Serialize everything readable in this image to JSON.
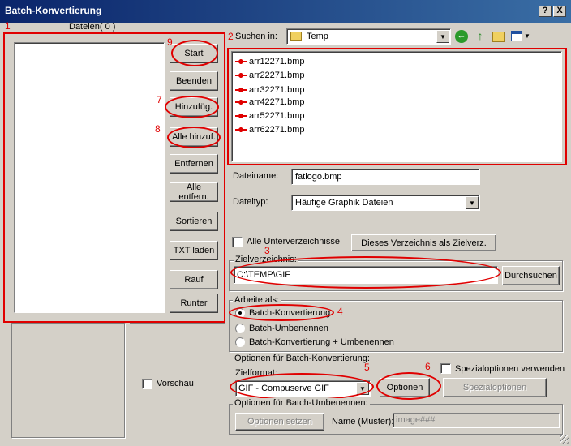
{
  "window": {
    "title": "Batch-Konvertierung",
    "help_label": "?",
    "close_label": "X"
  },
  "markers": [
    "1",
    "2",
    "3",
    "4",
    "5",
    "6",
    "7",
    "8",
    "9"
  ],
  "left": {
    "header": "Dateien( 0 )",
    "buttons": {
      "start": "Start",
      "beenden": "Beenden",
      "hinzufueg": "Hinzufüg.",
      "alle_hinzuf": "Alle hinzuf.",
      "entfernen": "Entfernen",
      "alle_entfern": "Alle entfern.",
      "sortieren": "Sortieren",
      "txt_laden": "TXT laden",
      "rauf": "Rauf",
      "runter": "Runter"
    },
    "preview_label": "Vorschau"
  },
  "browser": {
    "look_in_label": "Suchen in:",
    "look_in_value": "Temp",
    "files": [
      "arr12271.bmp",
      "arr22271.bmp",
      "arr32271.bmp",
      "arr42271.bmp",
      "arr52271.bmp",
      "arr62271.bmp"
    ],
    "filename_label": "Dateiname:",
    "filename_value": "fatlogo.bmp",
    "filetype_label": "Dateityp:",
    "filetype_value": "Häufige Graphik Dateien"
  },
  "subdirs_label": "Alle Unterverzeichnisse",
  "set_target_button": "Dieses Verzeichnis als Zielverz.",
  "target": {
    "label": "Zielverzeichnis:",
    "value": "C:\\TEMP\\GIF",
    "browse_button": "Durchsuchen"
  },
  "work_as": {
    "label": "Arbeite als:",
    "options": [
      "Batch-Konvertierung",
      "Batch-Umbenennen",
      "Batch-Konvertierung + Umbenennen"
    ],
    "selected": 0
  },
  "convert_options": {
    "label": "Optionen für Batch-Konvertierung:",
    "format_label": "Zielformat:",
    "format_value": "GIF - Compuserve GIF",
    "options_button": "Optionen",
    "special_check_label": "Spezialoptionen verwenden",
    "special_button": "Spezialoptionen"
  },
  "rename_options": {
    "label": "Optionen für Batch-Umbenennen:",
    "set_button": "Optionen setzen",
    "name_label": "Name (Muster):",
    "name_value": "image###"
  }
}
